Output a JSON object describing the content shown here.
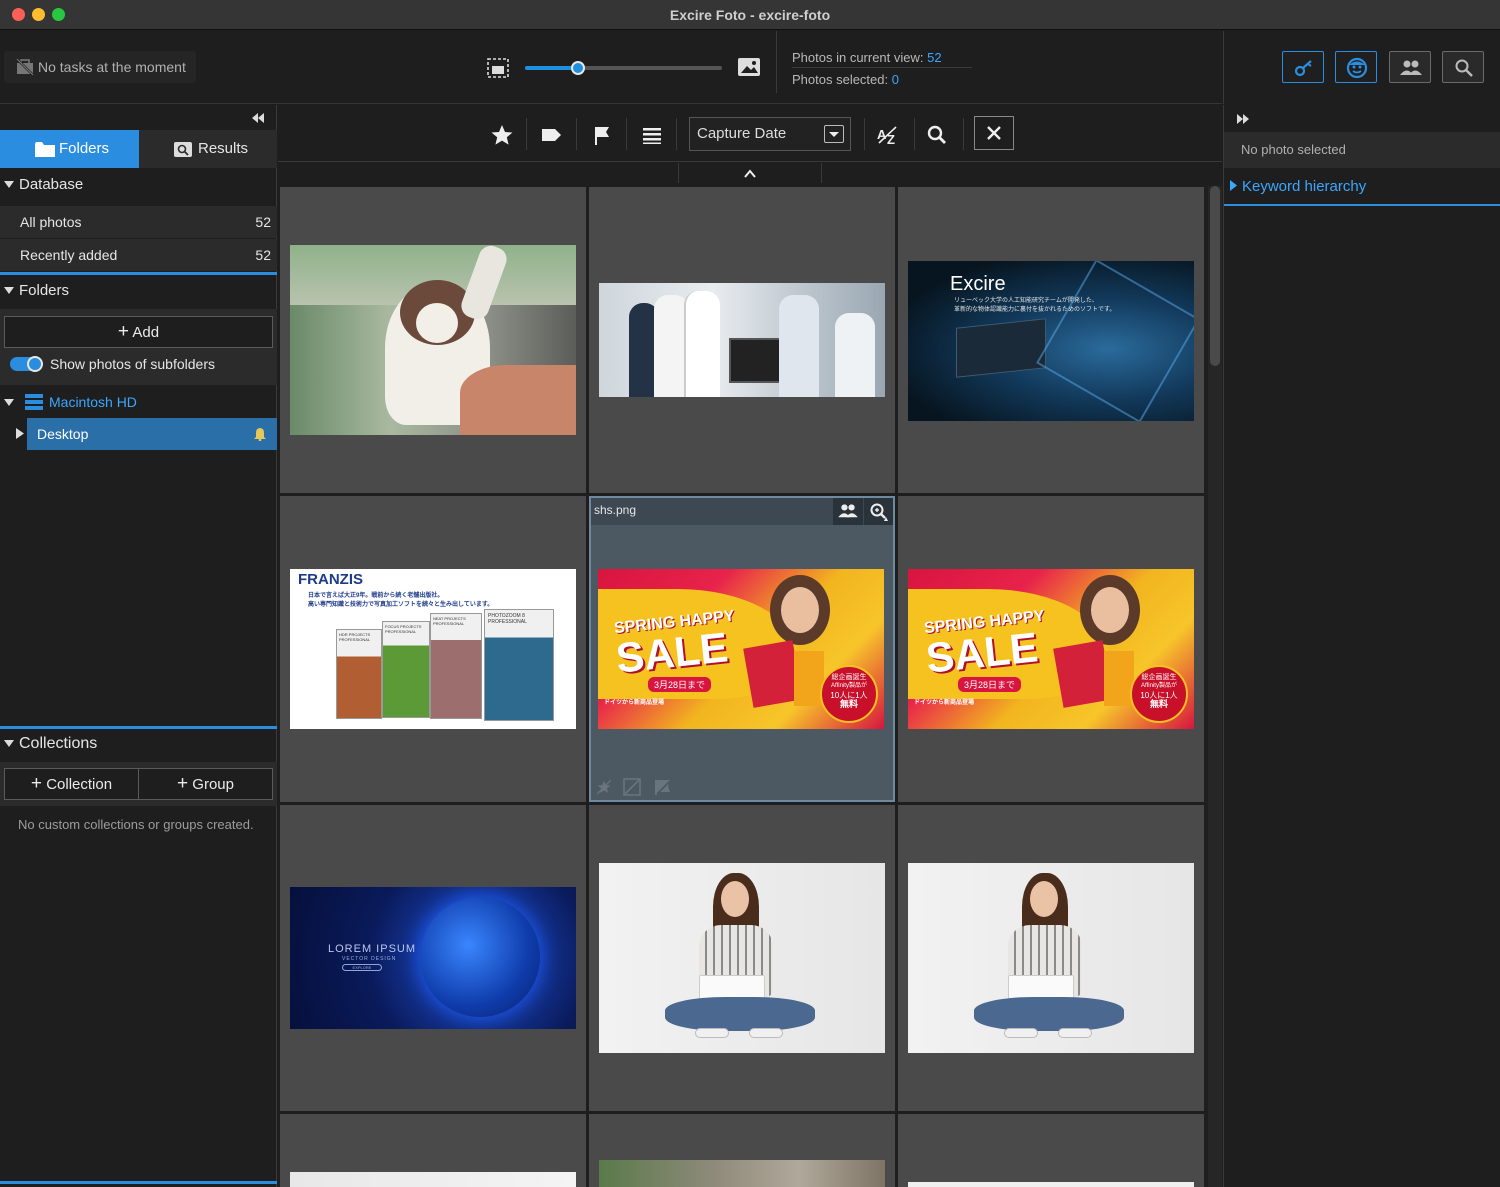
{
  "window": {
    "title": "Excire Foto - excire-foto"
  },
  "topbar": {
    "tasks_text": "No tasks at the moment",
    "zoom_level": 0.27,
    "photos_in_view_label": "Photos in current view:",
    "photos_in_view": "52",
    "photos_selected_label": "Photos selected:",
    "photos_selected": "0"
  },
  "right_toolbar": {
    "buttons": [
      "keyword-icon",
      "face-icon",
      "people-icon",
      "search-icon"
    ]
  },
  "left": {
    "tabs": {
      "folders": "Folders",
      "results": "Results"
    },
    "database": {
      "title": "Database",
      "items": [
        {
          "label": "All photos",
          "count": "52"
        },
        {
          "label": "Recently added",
          "count": "52"
        }
      ]
    },
    "folders": {
      "title": "Folders",
      "add_label": "Add",
      "show_subfolders_label": "Show photos of subfolders",
      "show_subfolders_on": true,
      "drive": "Macintosh HD",
      "folder": "Desktop"
    },
    "collections": {
      "title": "Collections",
      "collection_label": "Collection",
      "group_label": "Group",
      "empty_text": "No custom collections or groups created."
    }
  },
  "filterbar": {
    "sort_field": "Capture Date"
  },
  "grid": {
    "selected_file": "shs.png",
    "tiles": [
      {
        "kind": "cat"
      },
      {
        "kind": "office"
      },
      {
        "kind": "excire",
        "title": "Excire",
        "subtitle": "リューベック大学の人工知能研究チームが開発した、\n革新的な物体認識能力に裏付を抜かれるためのソフトです。"
      },
      {
        "kind": "franzis",
        "brand": "FRANZIS",
        "line1": "日本で言えば大正9年。戦前から続く老舗出版社。",
        "line2": "高い専門知識と技術力で写真加工ソフトを続々と生み出しています。",
        "boxes": [
          "HDR PROJECTS PROFESSIONAL",
          "FOCUS PROJECTS PROFESSIONAL",
          "NEAT PROJECTS PROFESSIONAL",
          "PHOTOZOOM 8 PROFESSIONAL"
        ]
      },
      {
        "kind": "sale",
        "l1": "SPRING HAPPY",
        "l2": "SALE",
        "date": "3月28日まで",
        "badge1": "総企画誕生",
        "badge2": "Affinity製品が",
        "badge3": "10人に1人",
        "badge4": "無料",
        "foot": "ドイツから新商品登場"
      },
      {
        "kind": "sale",
        "l1": "SPRING HAPPY",
        "l2": "SALE",
        "date": "3月28日まで",
        "badge1": "総企画誕生",
        "badge2": "Affinity製品が",
        "badge3": "10人に1人",
        "badge4": "無料",
        "foot": "ドイツから新商品登場"
      },
      {
        "kind": "lorem",
        "t1": "LOREM IPSUM",
        "t2": "VECTOR DESIGN",
        "t3": "EXPLORE"
      },
      {
        "kind": "woman"
      },
      {
        "kind": "woman"
      },
      {
        "kind": "partial"
      },
      {
        "kind": "partial2"
      },
      {
        "kind": "partial3"
      }
    ]
  },
  "right": {
    "no_selection": "No photo selected",
    "keyword_hierarchy": "Keyword hierarchy"
  },
  "colors": {
    "accent": "#2a8de0",
    "bg": "#1e1e1e",
    "panel": "#2b2b2b",
    "tile": "#4a4a4a"
  }
}
